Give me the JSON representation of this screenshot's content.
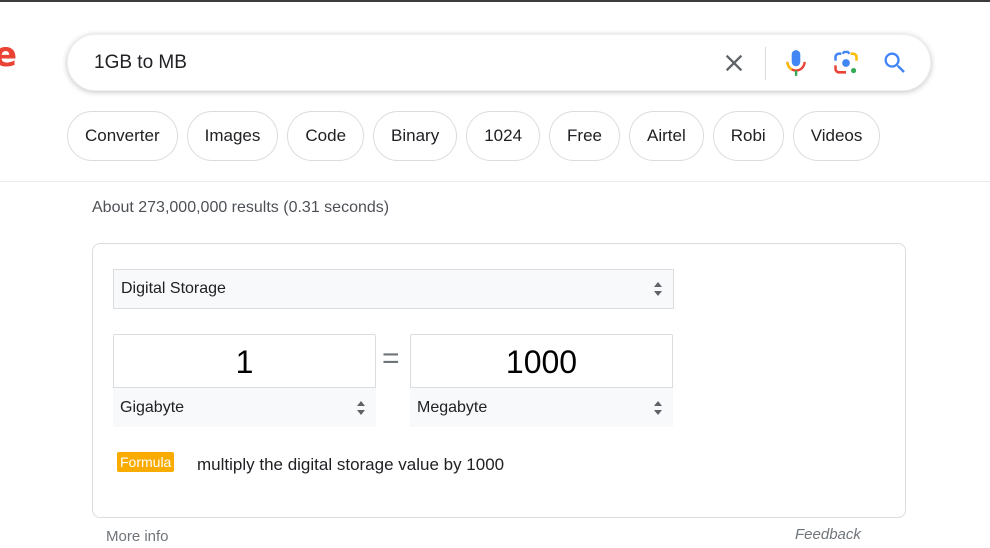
{
  "search": {
    "query": "1GB to MB",
    "icons": {
      "clear": "close-icon",
      "voice": "microphone-icon",
      "lens": "google-lens-icon",
      "submit": "search-icon"
    }
  },
  "logo": {
    "fragment": "e",
    "color": "#ea4335"
  },
  "chips": [
    {
      "label": "Converter"
    },
    {
      "label": "Images"
    },
    {
      "label": "Code"
    },
    {
      "label": "Binary"
    },
    {
      "label": "1024"
    },
    {
      "label": "Free"
    },
    {
      "label": "Airtel"
    },
    {
      "label": "Robi"
    },
    {
      "label": "Videos"
    }
  ],
  "result_stats": "About 273,000,000 results (0.31 seconds)",
  "converter": {
    "category": "Digital Storage",
    "from": {
      "value": "1",
      "unit": "Gigabyte"
    },
    "equals": "=",
    "to": {
      "value": "1000",
      "unit": "Megabyte"
    },
    "formula_label": "Formula",
    "formula_text": "multiply the digital storage value by 1000",
    "formula_color": "#f9ab00"
  },
  "footer": {
    "more_info": "More info",
    "feedback": "Feedback"
  }
}
